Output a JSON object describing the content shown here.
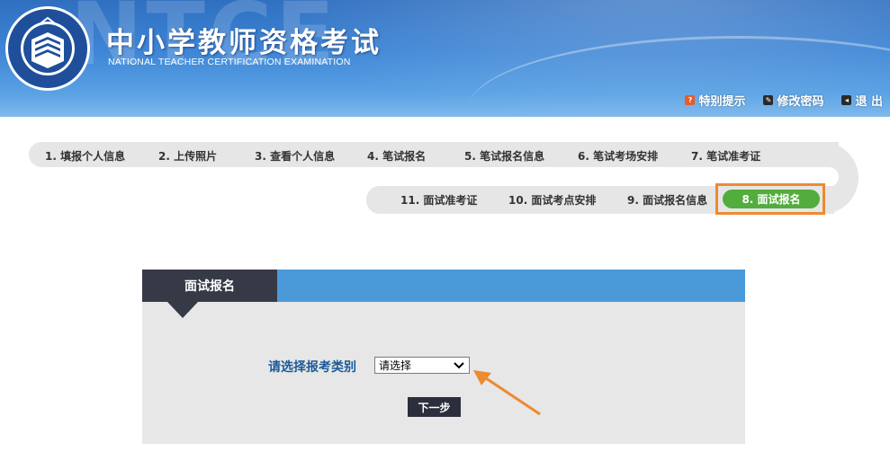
{
  "header": {
    "watermark": "NTCE",
    "title": "中小学教师资格考试",
    "subtitle": "NATIONAL TEACHER CERTIFICATION EXAMINATION",
    "logo_text": "National Teacher Certification Examination",
    "links": [
      {
        "label": "特别提示",
        "icon": "notice-icon",
        "color": "#e85b2a"
      },
      {
        "label": "修改密码",
        "icon": "key-icon",
        "color": "#333333"
      },
      {
        "label": "退 出",
        "icon": "logout-icon",
        "color": "#333333"
      }
    ]
  },
  "steps": {
    "row1": [
      "1. 填报个人信息",
      "2. 上传照片",
      "3. 查看个人信息",
      "4. 笔试报名",
      "5. 笔试报名信息",
      "6. 笔试考场安排",
      "7. 笔试准考证"
    ],
    "row2": [
      "11. 面试准考证",
      "10. 面试考点安排",
      "9. 面试报名信息"
    ],
    "active": "8. 面试报名",
    "active_color": "#53ad3e",
    "highlight_color": "#ee8a2f"
  },
  "panel": {
    "tab_title": "面试报名",
    "category_label": "请选择报考类别",
    "category_select": {
      "value": "请选择"
    },
    "next_button": "下一步"
  }
}
